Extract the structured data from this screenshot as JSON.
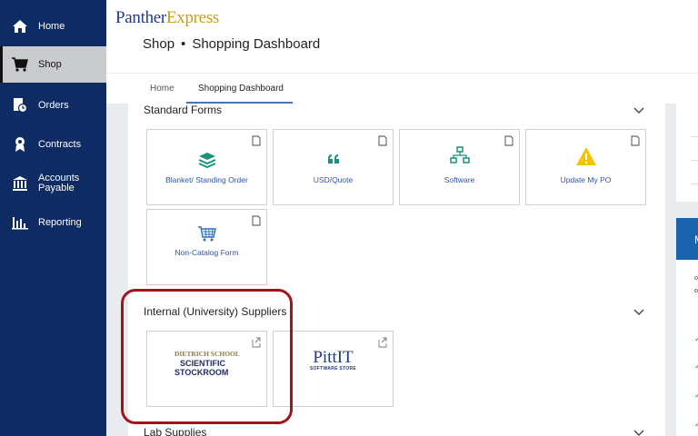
{
  "sidebar": {
    "items": [
      {
        "label": "Home",
        "icon": "home-icon"
      },
      {
        "label": "Shop",
        "icon": "cart-icon",
        "active": true
      },
      {
        "label": "Orders",
        "icon": "orders-icon"
      },
      {
        "label": "Contracts",
        "icon": "contracts-icon"
      },
      {
        "label": "Accounts",
        "label2": "Payable",
        "icon": "bank-icon"
      },
      {
        "label": "Reporting",
        "icon": "bar-chart-icon"
      }
    ]
  },
  "header": {
    "logo_part1": "Panther",
    "logo_part2": "Express",
    "breadcrumb_section": "Shop",
    "breadcrumb_separator": "•",
    "breadcrumb_page": "Shopping Dashboard"
  },
  "tabs": [
    {
      "label": "Home"
    },
    {
      "label": "Shopping Dashboard",
      "active": true
    }
  ],
  "sections": {
    "standard_forms": {
      "title": "Standard Forms",
      "cards": [
        {
          "label": "Blanket/ Standing Order",
          "icon": "layers-icon"
        },
        {
          "label": "USD/Quote",
          "icon": "quote-icon"
        },
        {
          "label": "Software",
          "icon": "network-icon"
        },
        {
          "label": "Update My PO",
          "icon": "warning-icon"
        },
        {
          "label": "Non-Catalog Form",
          "icon": "cart-icon"
        }
      ]
    },
    "internal_suppliers": {
      "title": "Internal (University) Suppliers",
      "cards": [
        {
          "logo_line1": "DIETRICH SCHOOL",
          "logo_line2": "SCIENTIFIC",
          "logo_line3": "STOCKROOM"
        },
        {
          "logo_main": "PittIT",
          "logo_sub": "SOFTWARE STORE"
        }
      ]
    },
    "lab_supplies": {
      "title": "Lab Supplies"
    }
  },
  "right_panel": {
    "header_letter": "M"
  },
  "colors": {
    "sidebar": "#0e2b63",
    "accent": "#4a73b6",
    "highlight": "#a11419",
    "link": "#2c54a8"
  }
}
